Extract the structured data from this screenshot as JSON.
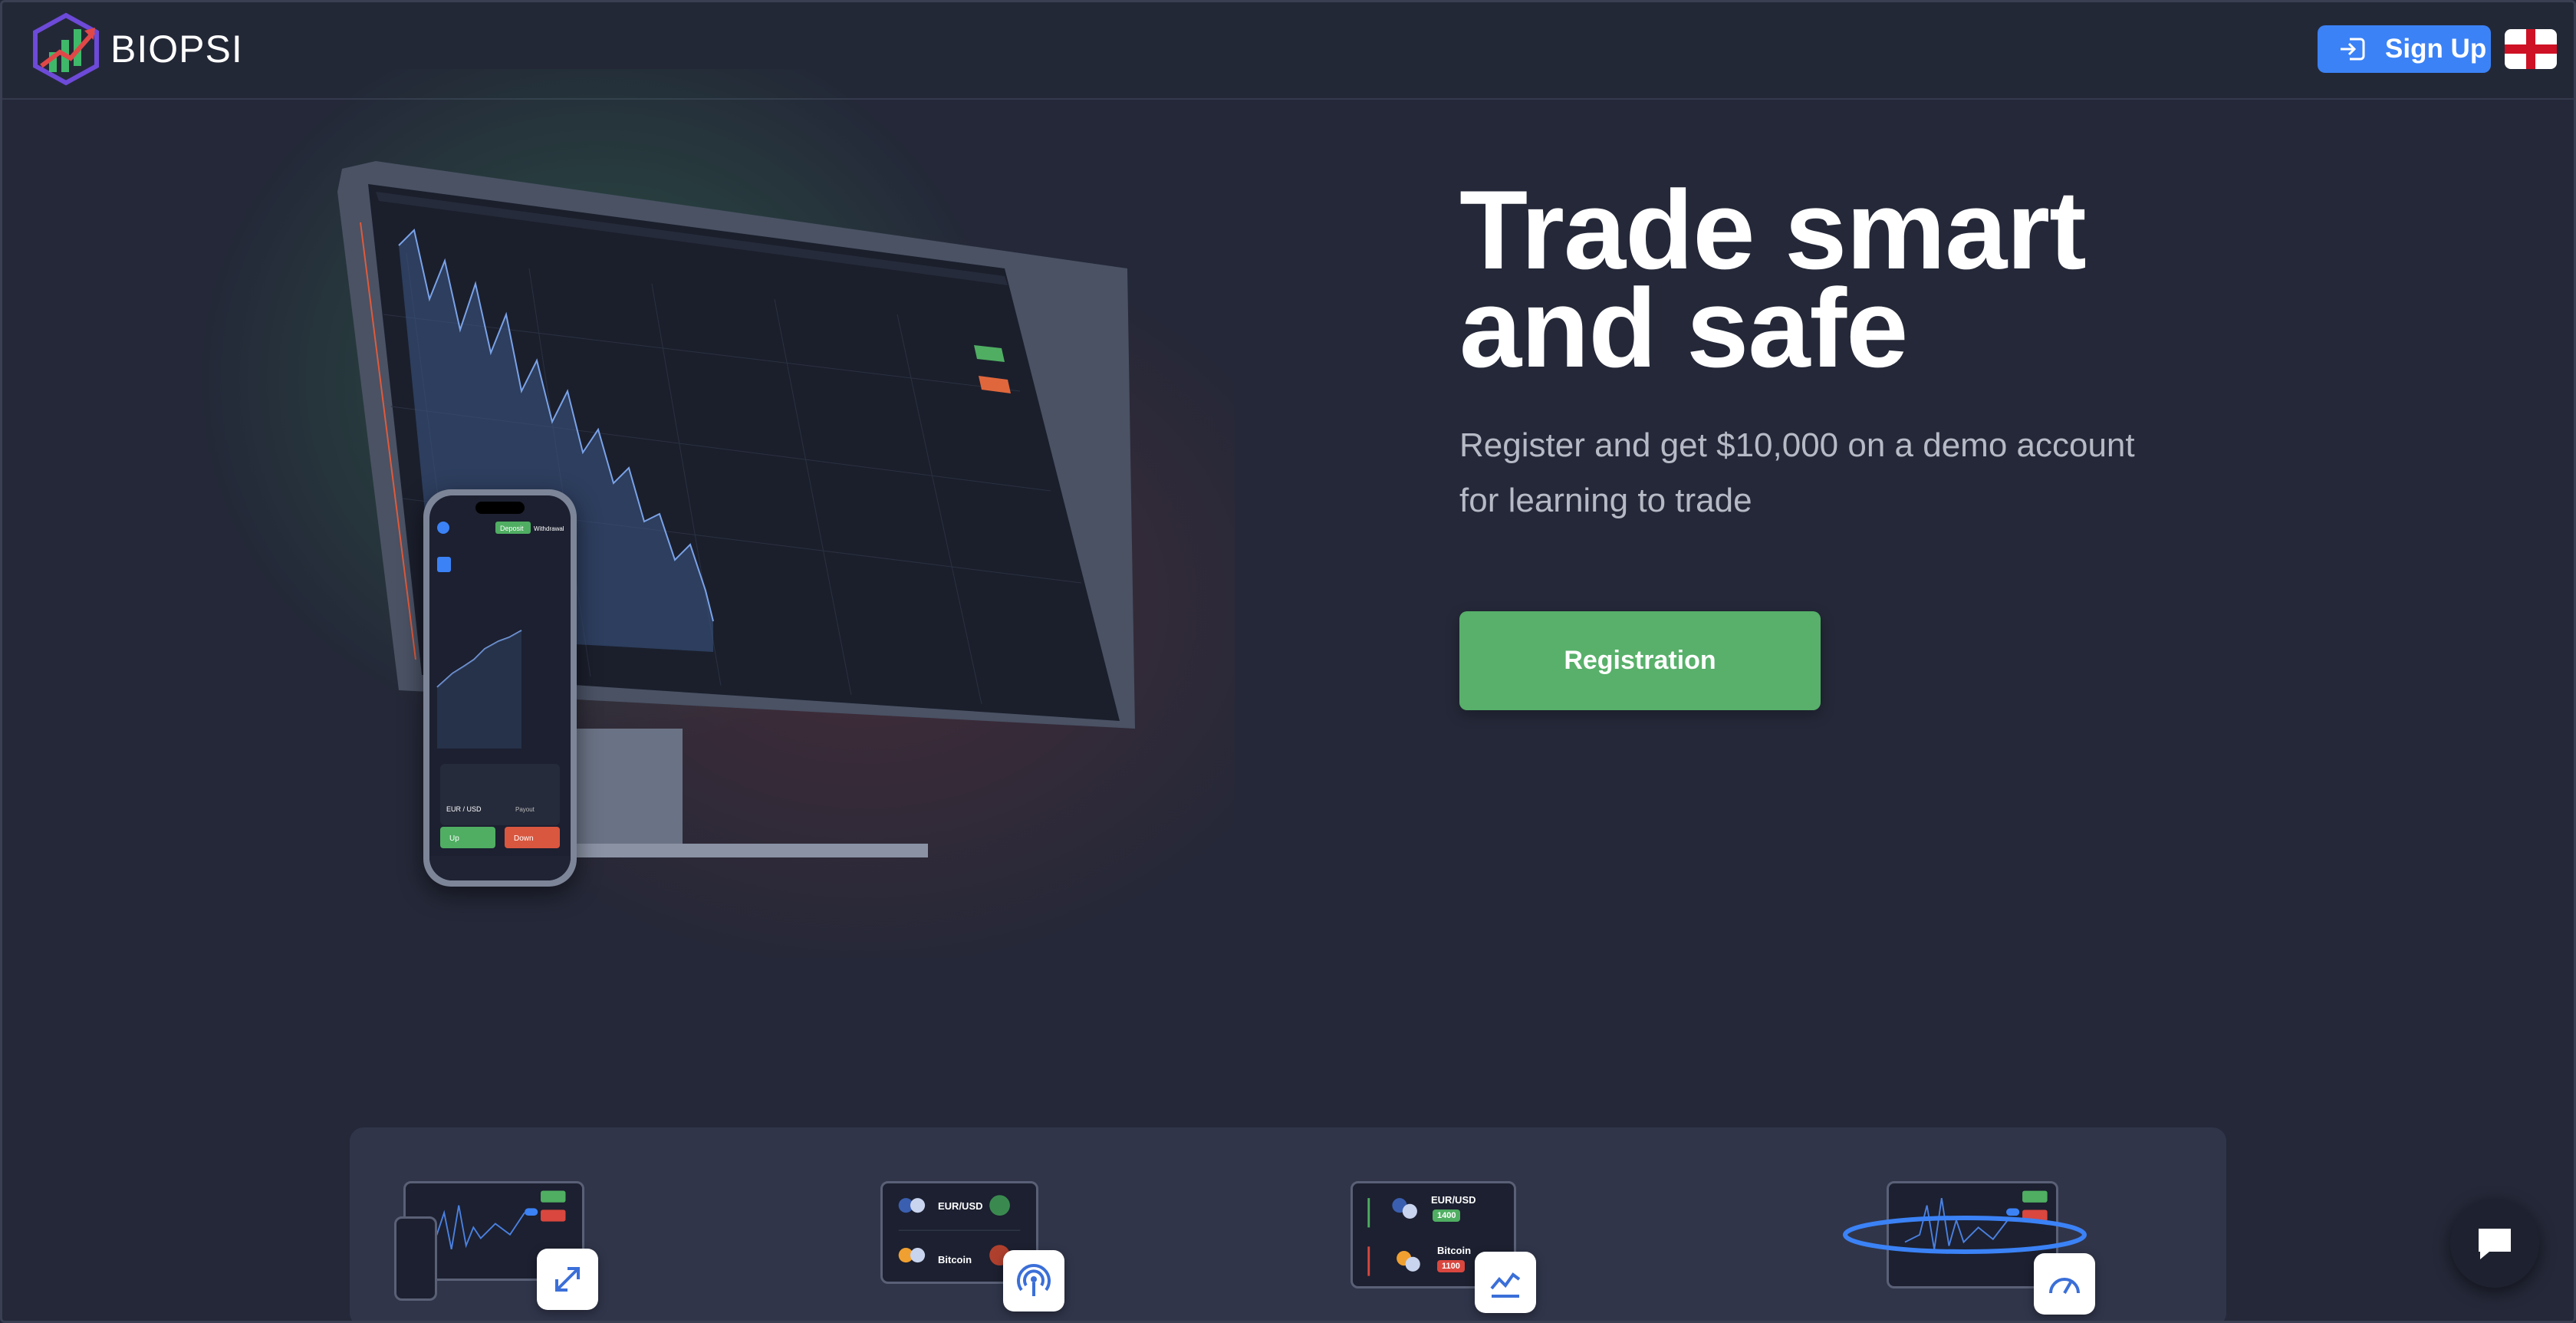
{
  "header": {
    "brand": "BIOPSI",
    "signup_label": "Sign Up",
    "language_icon": "england-flag-icon"
  },
  "hero": {
    "title_line1": "Trade smart",
    "title_line2": "and safe",
    "subtitle_line1": "Register and get $10,000 on a demo account",
    "subtitle_line2": "for learning to trade",
    "cta_label": "Registration"
  },
  "phone_mock": {
    "deposit_label": "Deposit",
    "withdraw_label": "Withdrawal",
    "up_label": "Up",
    "down_label": "Down",
    "pair_label": "EUR / USD",
    "payout_label": "Payout"
  },
  "features": [
    {
      "icon": "expand-icon"
    },
    {
      "icon": "signal-icon",
      "pair1": "EUR/USD",
      "pair2": "Bitcoin"
    },
    {
      "icon": "chart-line-icon",
      "pair1": "EUR/USD",
      "value1": "1400",
      "pair2": "Bitcoin",
      "value2": "1100"
    },
    {
      "icon": "speedometer-icon"
    }
  ],
  "colors": {
    "background": "#242838",
    "accent_blue": "#3b82f6",
    "accent_green": "#58b06a",
    "accent_red": "#d9534f"
  }
}
